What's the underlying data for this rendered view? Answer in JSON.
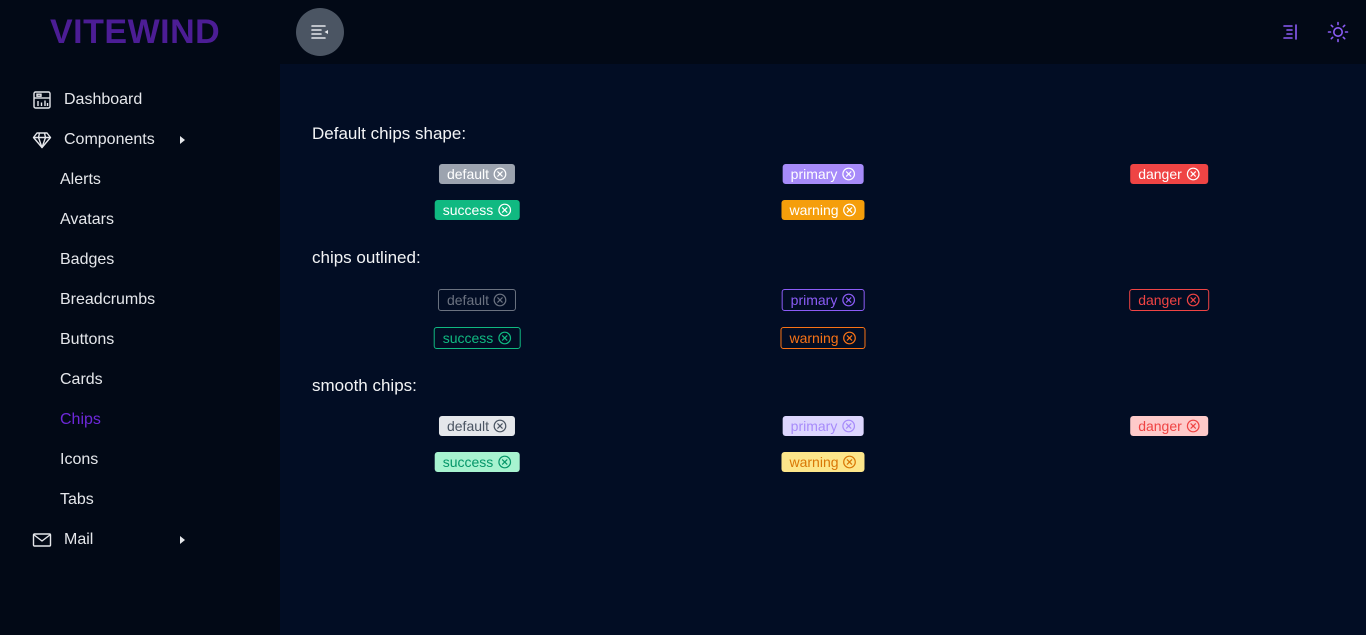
{
  "app": {
    "logo": "VITEWIND"
  },
  "header": {
    "menu_toggle_icon": "menu-collapse-icon",
    "right_icons": [
      "align-right-icon",
      "sun-icon"
    ]
  },
  "sidebar": {
    "items": [
      {
        "label": "Dashboard",
        "icon": "dashboard-icon"
      },
      {
        "label": "Components",
        "icon": "diamond-icon",
        "expandable": true
      },
      {
        "label": "Mail",
        "icon": "mail-icon",
        "expandable": true
      }
    ],
    "components": [
      "Alerts",
      "Avatars",
      "Badges",
      "Breadcrumbs",
      "Buttons",
      "Cards",
      "Chips",
      "Icons",
      "Tabs"
    ],
    "active": "Chips"
  },
  "sections": [
    {
      "title": "Default chips shape:",
      "style": "solid",
      "chips": [
        "default",
        "primary",
        "danger",
        "success",
        "warning"
      ]
    },
    {
      "title": "chips outlined:",
      "style": "outlined",
      "chips": [
        "default",
        "primary",
        "danger",
        "success",
        "warning"
      ]
    },
    {
      "title": "smooth chips:",
      "style": "smooth",
      "chips": [
        "default",
        "primary",
        "danger",
        "success",
        "warning"
      ]
    }
  ],
  "colors": {
    "accent": "#6d28d9",
    "solid": {
      "default": {
        "bg": "#9ca3af",
        "fg": "#ffffff"
      },
      "primary": {
        "bg": "#a78bfa",
        "fg": "#ffffff"
      },
      "danger": {
        "bg": "#ef4444",
        "fg": "#ffffff"
      },
      "success": {
        "bg": "#10b981",
        "fg": "#ffffff"
      },
      "warning": {
        "bg": "#f59e0b",
        "fg": "#ffffff"
      }
    },
    "outlined": {
      "default": "#6b7280",
      "primary": "#8b5cf6",
      "danger": "#ef4444",
      "success": "#10b981",
      "warning": "#f97316"
    },
    "smooth": {
      "default": {
        "bg": "#e5e7eb",
        "fg": "#4b5563"
      },
      "primary": {
        "bg": "#ddd6fe",
        "fg": "#a78bfa"
      },
      "danger": {
        "bg": "#fecaca",
        "fg": "#ef4444"
      },
      "success": {
        "bg": "#a7f3d0",
        "fg": "#059669"
      },
      "warning": {
        "bg": "#fde68a",
        "fg": "#d97706"
      }
    }
  }
}
